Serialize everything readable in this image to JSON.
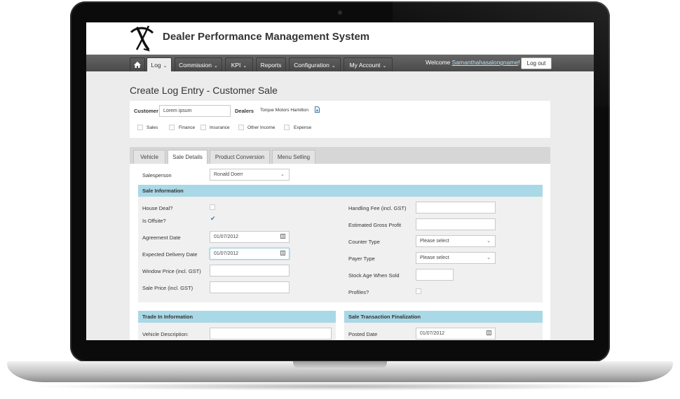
{
  "header": {
    "title": "Dealer Performance Management System"
  },
  "nav": {
    "tabs": [
      {
        "label": "Log"
      },
      {
        "label": "Commission"
      },
      {
        "label": "KPI"
      },
      {
        "label": "Reports"
      },
      {
        "label": "Configuration"
      },
      {
        "label": "My Account"
      }
    ],
    "welcome_prefix": "Welcome",
    "username": "Samanthahasalongname",
    "welcome_suffix": "!",
    "logout_label": "Log out"
  },
  "page": {
    "title": "Create Log Entry - Customer Sale"
  },
  "customer_panel": {
    "customer_label": "Customer",
    "customer_value": "Lorem ipsum",
    "dealers_label": "Dealers",
    "dealers_value": "Torque Motors Hamilton",
    "categories": [
      "Sales",
      "Finance",
      "Insurance",
      "Other Income",
      "Expense"
    ]
  },
  "form_tabs": [
    "Vehicle",
    "Sale Details",
    "Product Conversion",
    "Menu Selling"
  ],
  "salesperson": {
    "label": "Salesperson",
    "value": "Ronald Doerr"
  },
  "sale_info": {
    "title": "Sale Information",
    "house_deal": "House Deal?",
    "is_offsite": "Is Offsite?",
    "agreement_date_label": "Agreement Date",
    "agreement_date": "01/07/2012",
    "expected_delivery_label": "Expected Delivery Date",
    "expected_delivery": "01/07/2012",
    "window_price_label": "Window Price (incl. GST)",
    "sale_price_label": "Sale Price (incl. GST)",
    "handling_fee_label": "Handling Fee (incl. GST)",
    "estimated_gross_label": "Estimated Gross Profit",
    "counter_type_label": "Counter Type",
    "counter_type_placeholder": "Please select",
    "payer_type_label": "Payer Type",
    "payer_type_placeholder": "Please select",
    "stock_age_label": "Stock Age When Sold",
    "profiles_label": "Profiles?"
  },
  "trade_in": {
    "title": "Trade In Information",
    "vehicle_desc_label": "Vehicle Description:"
  },
  "finalization": {
    "title": "Sale Transaction Finalization",
    "posted_date_label": "Posted Date",
    "posted_date": "01/07/2012"
  },
  "colors": {
    "section_header": "#a9d8e6",
    "navbar": "#4a4a4a",
    "page_bg": "#ececec"
  }
}
